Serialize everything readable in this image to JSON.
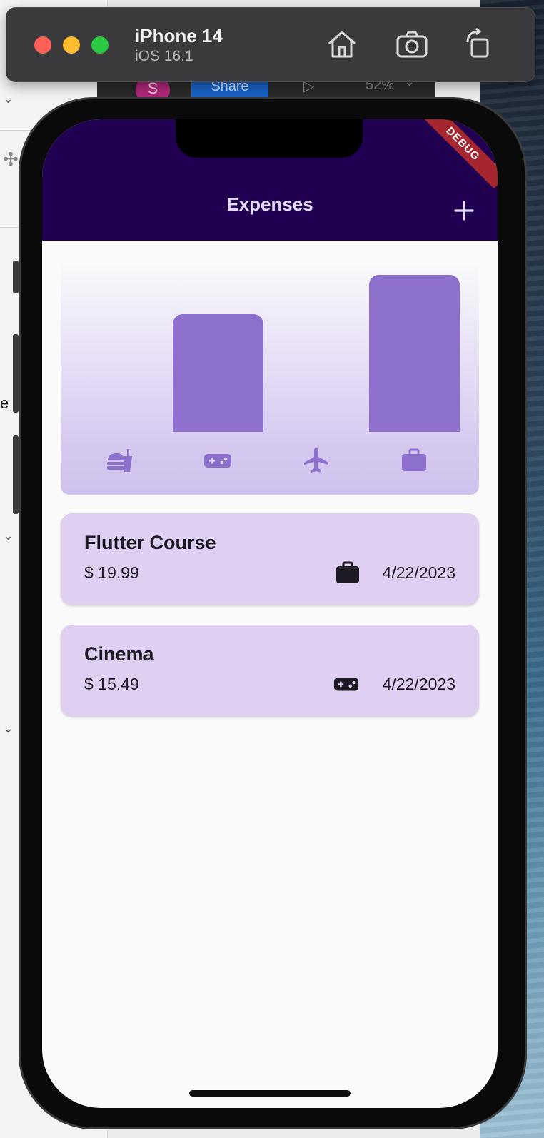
{
  "simulator": {
    "device_name": "iPhone 14",
    "os_version": "iOS 16.1",
    "icons": [
      "home-icon",
      "screenshot-icon",
      "rotate-icon"
    ]
  },
  "background": {
    "avatar_letter": "S",
    "share_label": "Share",
    "play_glyph": "▷",
    "zoom_level": "52%",
    "sidebar_fragment": "e"
  },
  "app": {
    "title": "Expenses",
    "debug_banner": "DEBUG",
    "colors": {
      "app_bar": "#200050",
      "title_text": "#e6dcff",
      "bar_fill": "#8c70cc",
      "card_bg": "#dfcff3",
      "debug_ribbon": "#a5262f"
    }
  },
  "chart_data": {
    "type": "bar",
    "categories": [
      "food",
      "leisure",
      "travel",
      "work"
    ],
    "category_icons": [
      "food-icon",
      "leisure-icon",
      "travel-icon",
      "work-icon"
    ],
    "values": [
      0,
      0.7503,
      0,
      1.0
    ],
    "ylim": [
      0,
      1
    ]
  },
  "expenses": [
    {
      "title": "Flutter Course",
      "amount": "$ 19.99",
      "date": "4/22/2023",
      "category_icon": "work-icon"
    },
    {
      "title": "Cinema",
      "amount": "$ 15.49",
      "date": "4/22/2023",
      "category_icon": "leisure-icon"
    }
  ]
}
